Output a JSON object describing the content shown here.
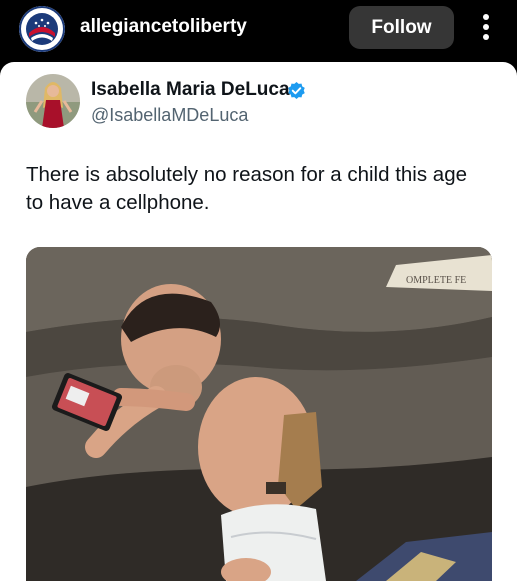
{
  "header": {
    "username": "allegiancetoliberty",
    "follow_label": "Follow",
    "avatar_icon": "allegiance-logo-icon",
    "more_icon": "vertical-ellipsis-icon"
  },
  "tweet": {
    "author_name": "Isabella Maria DeLuca",
    "author_handle": "@IsabellaMDeLuca",
    "verified": true,
    "text_line1": "There is absolutely no reason for a child this age",
    "text_line2": "to have a cellphone.",
    "photo_description_icon": "baby-with-phone-photo",
    "photo_visible_text": "OMPLETE FE"
  },
  "colors": {
    "background": "#000000",
    "card": "#ffffff",
    "follow_button": "#363636",
    "verified_blue": "#1d9bf0",
    "handle_gray": "#536471",
    "text": "#0f1419"
  }
}
